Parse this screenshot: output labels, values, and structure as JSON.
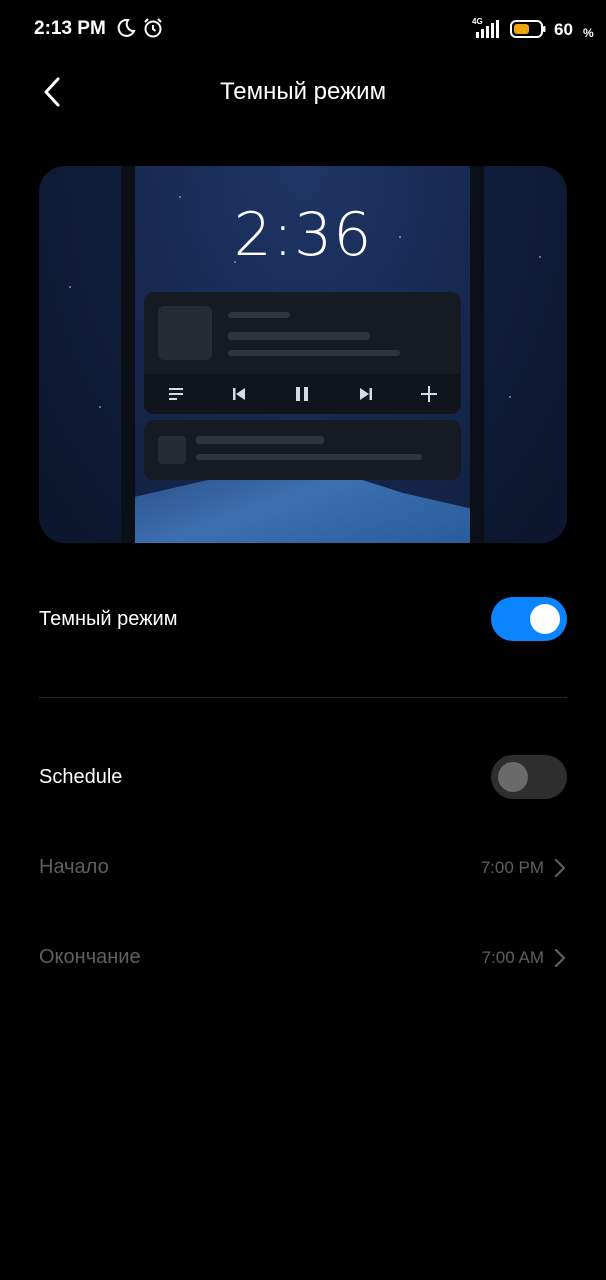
{
  "status_bar": {
    "time": "2:13 PM",
    "network": "4G",
    "battery_percent": "60",
    "battery_sign": "%",
    "battery_level": 0.6,
    "icons": [
      "moon-icon",
      "alarm-icon",
      "signal-icon",
      "battery-icon"
    ]
  },
  "header": {
    "title": "Темный режим",
    "back_icon": "chevron-left-icon"
  },
  "preview": {
    "clock": "2:36",
    "media_controls": [
      "menu-icon",
      "skip-previous-icon",
      "pause-icon",
      "skip-next-icon",
      "plus-icon"
    ]
  },
  "settings": {
    "dark_mode": {
      "label": "Темный режим",
      "enabled": true
    },
    "schedule": {
      "label": "Schedule",
      "enabled": false
    },
    "start": {
      "label": "Начало",
      "value": "7:00 PM"
    },
    "end": {
      "label": "Окончание",
      "value": "7:00 AM"
    }
  },
  "colors": {
    "accent": "#0a84ff",
    "toggle_off_track": "#2e2e2e",
    "disabled_text": "#5f5f5f",
    "battery_fill": "#f0a30a"
  }
}
